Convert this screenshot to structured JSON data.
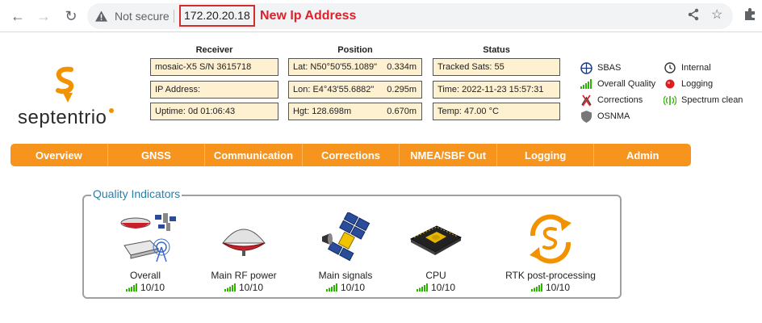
{
  "browser": {
    "security_label": "Not secure",
    "url": "172.20.20.18",
    "annotation": "New Ip Address"
  },
  "brand": {
    "name": "septentrio"
  },
  "columns": {
    "receiver": "Receiver",
    "position": "Position",
    "status": "Status"
  },
  "receiver": {
    "model": "mosaic-X5 S/N 3615718",
    "ip": "IP Address:",
    "uptime": "Uptime: 0d 01:06:43"
  },
  "position": {
    "lat": "Lat:  N50°50'55.1089\"",
    "lat_acc": "0.334m",
    "lon": "Lon: E4°43'55.6882\"",
    "lon_acc": "0.295m",
    "hgt": "Hgt:  128.698m",
    "hgt_acc": "0.670m"
  },
  "status": {
    "sats": "Tracked Sats: 55",
    "time": "Time: 2022-11-23 15:57:31",
    "temp": "Temp: 47.00 °C"
  },
  "legend": {
    "sbas": "SBAS",
    "overall_quality": "Overall Quality",
    "corrections": "Corrections",
    "osnma": "OSNMA",
    "internal": "Internal",
    "logging": "Logging",
    "spectrum": "Spectrum clean"
  },
  "menu": [
    "Overview",
    "GNSS",
    "Communication",
    "Corrections",
    "NMEA/SBF Out",
    "Logging",
    "Admin"
  ],
  "quality": {
    "title": "Quality Indicators",
    "items": [
      {
        "label": "Overall",
        "value": "10/10",
        "icon": "receiver-satellite-icon"
      },
      {
        "label": "Main RF power",
        "value": "10/10",
        "icon": "antenna-icon"
      },
      {
        "label": "Main signals",
        "value": "10/10",
        "icon": "satellite-icon"
      },
      {
        "label": "CPU",
        "value": "10/10",
        "icon": "cpu-chip-icon"
      },
      {
        "label": "RTK post-processing",
        "value": "10/10",
        "icon": "rtk-refresh-icon"
      }
    ]
  },
  "colors": {
    "accent": "#f7941d",
    "panel": "#fdf1d2",
    "title_blue": "#2a7fa6",
    "signal_green": "#2db400",
    "annotation_red": "#e0202b"
  }
}
